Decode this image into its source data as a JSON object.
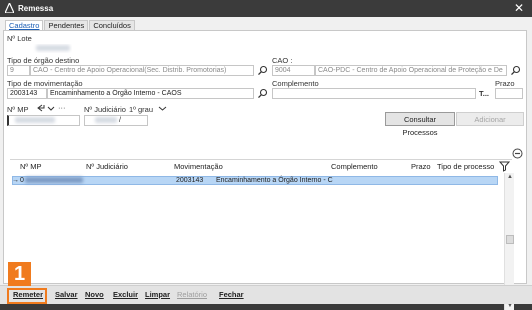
{
  "window": {
    "title": "Remessa",
    "close_glyph": "✕"
  },
  "tabs": [
    {
      "label": "Cadastro",
      "active": true
    },
    {
      "label": "Pendentes",
      "active": false
    },
    {
      "label": "Concluídos",
      "active": false
    }
  ],
  "form": {
    "n_lote_label": "Nº Lote",
    "tipo_orgao_label": "Tipo de órgão destino",
    "tipo_orgao_code": "9",
    "tipo_orgao_value": "CAO - Centro de Apoio Operacional(Sec. Distrib. Promotorias)",
    "cao_label": "CAO :",
    "cao_code": "9004",
    "cao_value": "CAO-PDC - Centro de Apoio Operacional de Proteção e De",
    "tipo_mov_label": "Tipo de movimentação",
    "tipo_mov_code": "2003143",
    "tipo_mov_value": "Encaminhamento a Órgão Interno - CAOS",
    "complemento_label": "Complemento",
    "complemento_btn": "T...",
    "prazo_label": "Prazo",
    "n_mp_label": "Nº MP",
    "n_judiciario_label": "Nº Judiciário",
    "grau_value": "1º grau",
    "n_judiciario_value": "/",
    "consultar_btn": "Consultar Processos",
    "adicionar_btn": "Adicionar"
  },
  "grid": {
    "columns": [
      "Nº MP",
      "Nº Judiciário",
      "Movimentação",
      "Complemento",
      "Prazo",
      "Tipo de processo"
    ],
    "rows": [
      {
        "row_marker": "→",
        "n_mp": "0",
        "n_judiciario": "",
        "mov_code": "2003143",
        "mov_text": "Encaminhamento a Órgão Interno - C"
      }
    ]
  },
  "bottom_buttons": [
    {
      "label": "Remeter",
      "enabled": true
    },
    {
      "label": "Salvar",
      "enabled": true
    },
    {
      "label": "Novo",
      "enabled": true
    },
    {
      "label": "Excluir",
      "enabled": true
    },
    {
      "label": "Limpar",
      "enabled": true
    },
    {
      "label": "Relatório",
      "enabled": false
    },
    {
      "label": "Fechar",
      "enabled": true
    }
  ],
  "annotation": {
    "badge": "1"
  },
  "colors": {
    "accent": "#f07b1e",
    "selection": "#b8d6f5",
    "titlebar": "#3b3b3b"
  },
  "icons": [
    "app-icon",
    "close-icon",
    "search-icon",
    "back-arrow-icon",
    "chevron-down-icon",
    "filter-icon",
    "remove-row-icon"
  ]
}
